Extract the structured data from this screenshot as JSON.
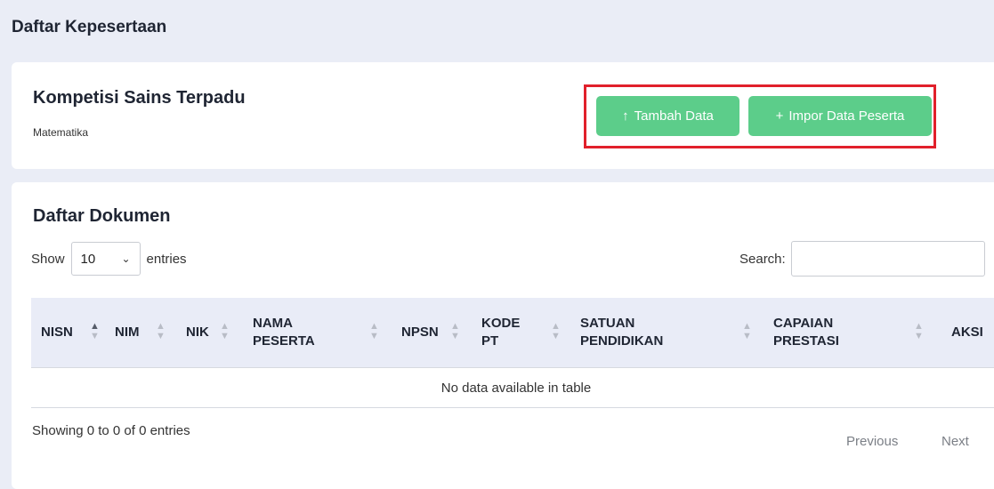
{
  "page": {
    "title": "Daftar Kepesertaan"
  },
  "competition": {
    "title": "Kompetisi Sains Terpadu",
    "subject": "Matematika"
  },
  "actions": {
    "tambah": {
      "icon": "↑",
      "label": "Tambah Data"
    },
    "impor": {
      "icon": "+",
      "label": "Impor Data Peserta"
    }
  },
  "documents": {
    "title": "Daftar Dokumen",
    "show_label": "Show",
    "entries_value": "10",
    "entries_label": "entries",
    "search_label": "Search:",
    "search_value": ""
  },
  "table": {
    "columns": [
      "NISN",
      "NIM",
      "NIK",
      "NAMA PESERTA",
      "NPSN",
      "KODE PT",
      "SATUAN PENDIDIKAN",
      "CAPAIAN PRESTASI",
      "AKSI"
    ],
    "empty_text": "No data available in table",
    "info": "Showing 0 to 0 of 0 entries",
    "previous": "Previous",
    "next": "Next"
  },
  "colors": {
    "accent_button": "#5ccd8a",
    "highlight_border": "#e1202b",
    "background": "#eaedf6"
  }
}
